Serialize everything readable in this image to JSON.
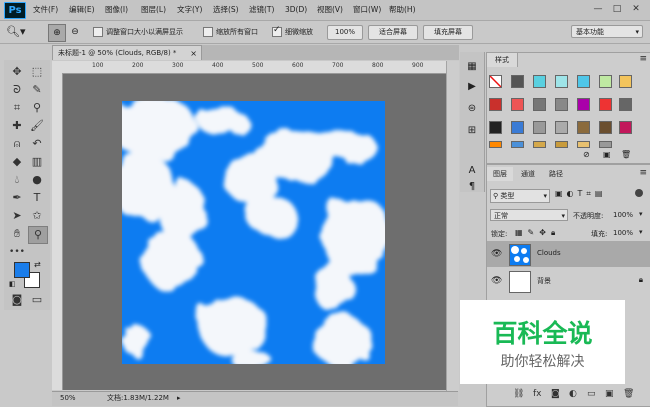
{
  "app": {
    "logo": "Ps"
  },
  "menu": [
    "文件(F)",
    "编辑(E)",
    "图像(I)",
    "图层(L)",
    "文字(Y)",
    "选择(S)",
    "滤镜(T)",
    "3D(D)",
    "视图(V)",
    "窗口(W)",
    "帮助(H)"
  ],
  "window_controls": {
    "minimize": "—",
    "maximize": "□",
    "close": "✕"
  },
  "options": {
    "resize_windows_label": "调整窗口大小以满屏显示",
    "zoom_all_label": "缩放所有窗口",
    "scrubby_zoom_label": "细微缩放",
    "scrubby_checked": true,
    "zoom100_label": "100%",
    "fit_screen_label": "适合屏幕",
    "fill_screen_label": "填充屏幕",
    "workspace": "基本功能"
  },
  "document": {
    "tab_title": "未标题-1 @ 50% (Clouds, RGB/8) *",
    "zoom": "50%",
    "doc_info": "文档:1.83M/1.22M",
    "ruler_marks": [
      "100",
      "200",
      "300",
      "400",
      "500",
      "600",
      "700",
      "800",
      "900"
    ]
  },
  "colors": {
    "foreground": "#1a7dea",
    "background": "#ffffff",
    "sky": "#0d7cf1"
  },
  "styles_panel": {
    "tab": "样式"
  },
  "layers_panel": {
    "tabs": [
      "图层",
      "通道",
      "路径"
    ],
    "filter_kind": "类型",
    "blend_mode": "正常",
    "opacity_label": "不透明度:",
    "opacity_value": "100%",
    "lock_label": "锁定:",
    "fill_label": "填充:",
    "fill_value": "100%",
    "layers": [
      {
        "name": "Clouds",
        "selected": true
      },
      {
        "name": "背景",
        "selected": false
      }
    ]
  },
  "watermark": {
    "title": "百科全说",
    "subtitle": "助你轻松解决"
  }
}
